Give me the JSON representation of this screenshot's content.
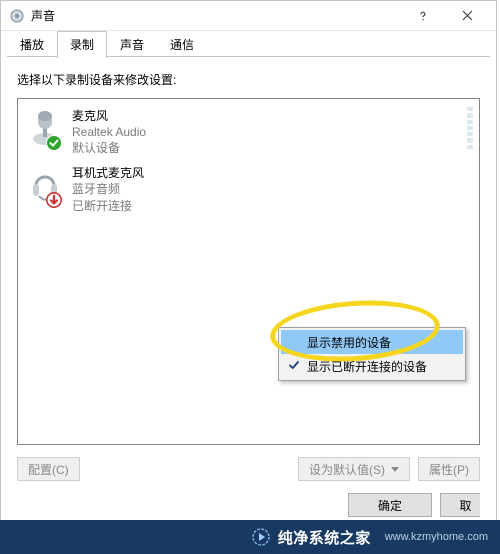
{
  "window": {
    "title": "声音",
    "help_icon": "help-icon",
    "close_icon": "close-icon"
  },
  "tabs": [
    {
      "label": "播放",
      "active": false
    },
    {
      "label": "录制",
      "active": true
    },
    {
      "label": "声音",
      "active": false
    },
    {
      "label": "通信",
      "active": false
    }
  ],
  "prompt": "选择以下录制设备来修改设置:",
  "devices": [
    {
      "name": "麦克风",
      "line2": "Realtek Audio",
      "line3": "默认设备",
      "icon": "microphone-icon",
      "badge": "check-badge",
      "has_meter": true
    },
    {
      "name": "耳机式麦克风",
      "line2": "蓝牙音频",
      "line3": "已断开连接",
      "icon": "headset-icon",
      "badge": "down-badge",
      "has_meter": false
    }
  ],
  "context_menu": {
    "items": [
      {
        "label": "显示禁用的设备",
        "checked": false,
        "highlight": true
      },
      {
        "label": "显示已断开连接的设备",
        "checked": true,
        "highlight": false
      }
    ]
  },
  "buttons": {
    "configure": "配置(C)",
    "set_default": "设为默认值(S)",
    "properties": "属性(P)",
    "ok": "确定",
    "cancel_prefix": "取"
  },
  "watermark": {
    "brand": "纯净系统之家",
    "url": "www.kzmyhome.com"
  },
  "colors": {
    "highlight": "#90c8f6",
    "annotation": "#f5d51d",
    "footer": "#183a62"
  }
}
